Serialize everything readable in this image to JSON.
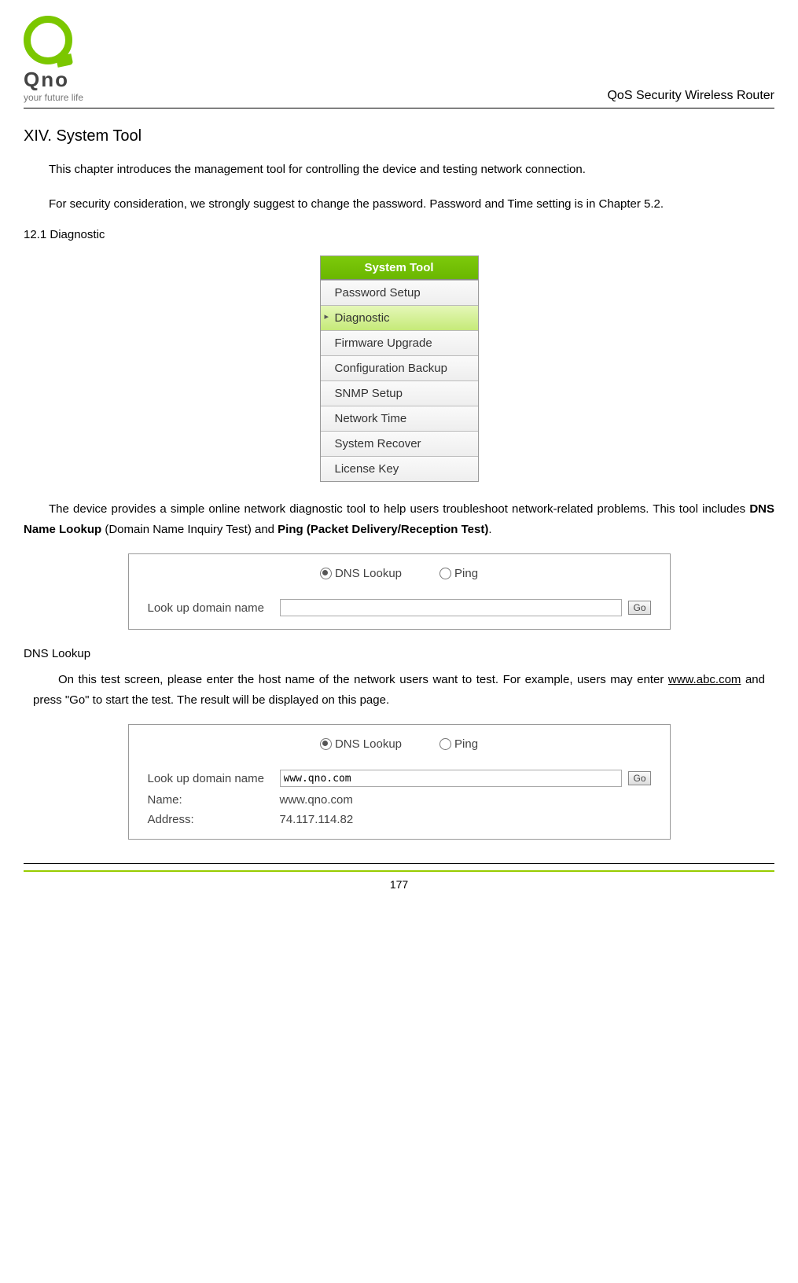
{
  "header": {
    "logo_text": "Qno",
    "logo_tag": "your future life",
    "title": "QoS Security Wireless Router"
  },
  "section": {
    "heading": "XIV. System Tool",
    "para1": "This chapter introduces the management tool for controlling the device and testing network connection.",
    "para2": "For security consideration, we strongly suggest to change the password. Password and Time setting is in Chapter 5.2.",
    "subhead": "12.1 Diagnostic"
  },
  "menu": {
    "header": "System Tool",
    "items": [
      {
        "label": "Password Setup",
        "active": false
      },
      {
        "label": "Diagnostic",
        "active": true
      },
      {
        "label": "Firmware Upgrade",
        "active": false
      },
      {
        "label": "Configuration Backup",
        "active": false
      },
      {
        "label": "SNMP Setup",
        "active": false
      },
      {
        "label": "Network Time",
        "active": false
      },
      {
        "label": "System Recover",
        "active": false
      },
      {
        "label": "License Key",
        "active": false
      }
    ]
  },
  "para3_pre": "The device provides a simple online network diagnostic tool to help users troubleshoot network-related problems. This tool includes ",
  "para3_bold1": "DNS Name Lookup",
  "para3_mid": " (Domain Name Inquiry Test) and ",
  "para3_bold2": "Ping (Packet Delivery/Reception Test)",
  "para3_post": ".",
  "panel1": {
    "radio_dns": "DNS Lookup",
    "radio_ping": "Ping",
    "lookup_label": "Look up domain name",
    "input_value": "",
    "go_label": "Go"
  },
  "dns_heading": "DNS Lookup",
  "para4_pre": "On this test screen, please enter the host name of the network users want to test. For example, users may enter ",
  "para4_link": "www.abc.com",
  "para4_post": " and press \"Go\" to start the test. The result will be displayed on this page.",
  "panel2": {
    "radio_dns": "DNS Lookup",
    "radio_ping": "Ping",
    "lookup_label": "Look up domain name",
    "input_value": "www.qno.com",
    "go_label": "Go",
    "name_label": "Name:",
    "name_value": "www.qno.com",
    "addr_label": "Address:",
    "addr_value": "74.117.114.82"
  },
  "page_number": "177"
}
